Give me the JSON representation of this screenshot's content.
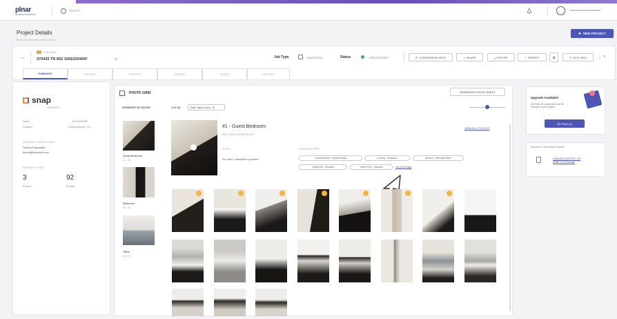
{
  "app": {
    "logo": "plnar"
  },
  "search": {
    "placeholder": "Search"
  },
  "page": {
    "title": "Project Details",
    "subtitle": "Project information and updates",
    "new_project_label": "NEW PROJECT"
  },
  "project": {
    "back_label": "←",
    "label": "Pdf Name",
    "id": "370433 TR-562 1091025400F",
    "job_type_label": "Job Type",
    "job_type_value": "SNAPSHOT",
    "status_label": "Status",
    "status_value": "PROCESSED",
    "status_color": "#2bb673",
    "buttons": [
      "COMPARISON VIEW",
      "SHARE",
      "EXPORT",
      "REPORT",
      "",
      "EDIT INFO"
    ]
  },
  "tabs": [
    "SUMMARY",
    "DETAILS",
    "PHOTOS",
    "ROOMS",
    "NOTES",
    "HISTORY"
  ],
  "left": {
    "brand": "snap",
    "brand_sub": "SNAPSHOT",
    "kv": [
      {
        "k": "Name",
        "v": "1091025400F"
      },
      {
        "k": "Location",
        "v": "Dural Balance, Co."
      }
    ],
    "contact_heading": "INSURED CONTACT INFO",
    "contact_name": "Tommy Palavalege",
    "contact_email": "tommy@example.com",
    "stats_heading": "PROPERTY INFO",
    "stats": [
      {
        "num": "3",
        "label": "Rooms"
      },
      {
        "num": "92",
        "label": "Photos"
      }
    ]
  },
  "main": {
    "title": "PHOTO GRID",
    "generate_label": "GENERATE PHOTO SHEET",
    "sidebar_heading": "SUMMARY BY ROOM",
    "sort_label": "Sort By",
    "sort_value": "Date Taken (Asc)",
    "rooms": [
      {
        "name": "Guest Bedroom",
        "count": "24 - 26"
      },
      {
        "name": "Bathroom",
        "count": "26 - 42"
      },
      {
        "name": "Office",
        "count": "43 - 62"
      }
    ],
    "detail": {
      "title": "#1 - Guest Bedroom",
      "subtitle": "03.27.2019 12:43:56 PM EST",
      "view_link": "VIEW ALL PHOTOS",
      "notes_heading": "NOTES",
      "notes_text": "No notes / description provided",
      "ai_heading": "AI DESCRIPTORS",
      "chips": [
        "Guest Bedroom - Overall Setting",
        "Flooring - Hardwood",
        "Window - Horizontal Slider",
        "Ceiling Fan - Standard",
        "Interior Door - Standard"
      ],
      "see_all": "see all 96 tags"
    }
  },
  "right": {
    "upgrade_title": "Upgrade Available!",
    "upgrade_text": "Get Plnar 3D to generate a full 3D floorplan for your project.",
    "upgrade_btn": "3D Plnar Up",
    "docs_heading": "Estimate & Generated Reports",
    "docs_link": "DAMAGED_REPORT_GR 80882_XXX.Estimate"
  }
}
